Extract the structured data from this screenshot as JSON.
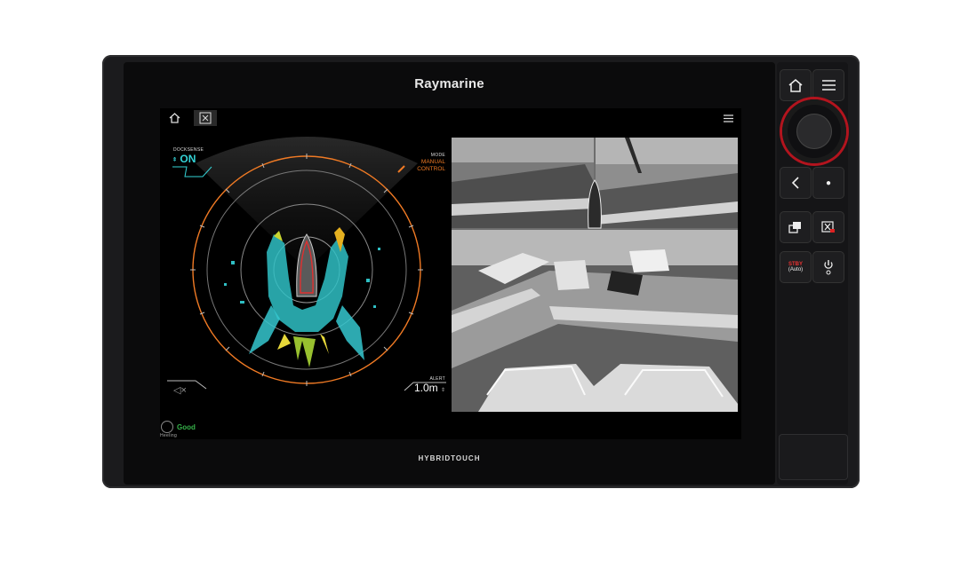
{
  "device": {
    "brand": "Raymarine",
    "model_label": "HYBRIDTOUCH"
  },
  "screen": {
    "topbar": {
      "home_icon": "home-icon",
      "docking_icon": "dock-icon",
      "menu_icon": "menu-icon"
    },
    "docksense": {
      "label": "DOCKSENSE",
      "value": "ON"
    },
    "mode": {
      "label": "MODE",
      "value_line1": "MANUAL",
      "value_line2": "CONTROL"
    },
    "alert": {
      "label": "ALERT",
      "value": "1.0m"
    },
    "heeling": {
      "label": "Heeling",
      "status": "Good"
    },
    "colors": {
      "accent": "#f07a24",
      "cyan": "#34d3d6",
      "good": "#36b24a"
    }
  },
  "side_buttons": {
    "home": "home-icon",
    "menu": "menu-icon",
    "back": "back-icon",
    "dot": "ok-icon",
    "switch": "switch-app-icon",
    "mob": "man-overboard-icon",
    "stby_label": "STBY",
    "auto_label": "(Auto)",
    "power": "power-icon"
  }
}
